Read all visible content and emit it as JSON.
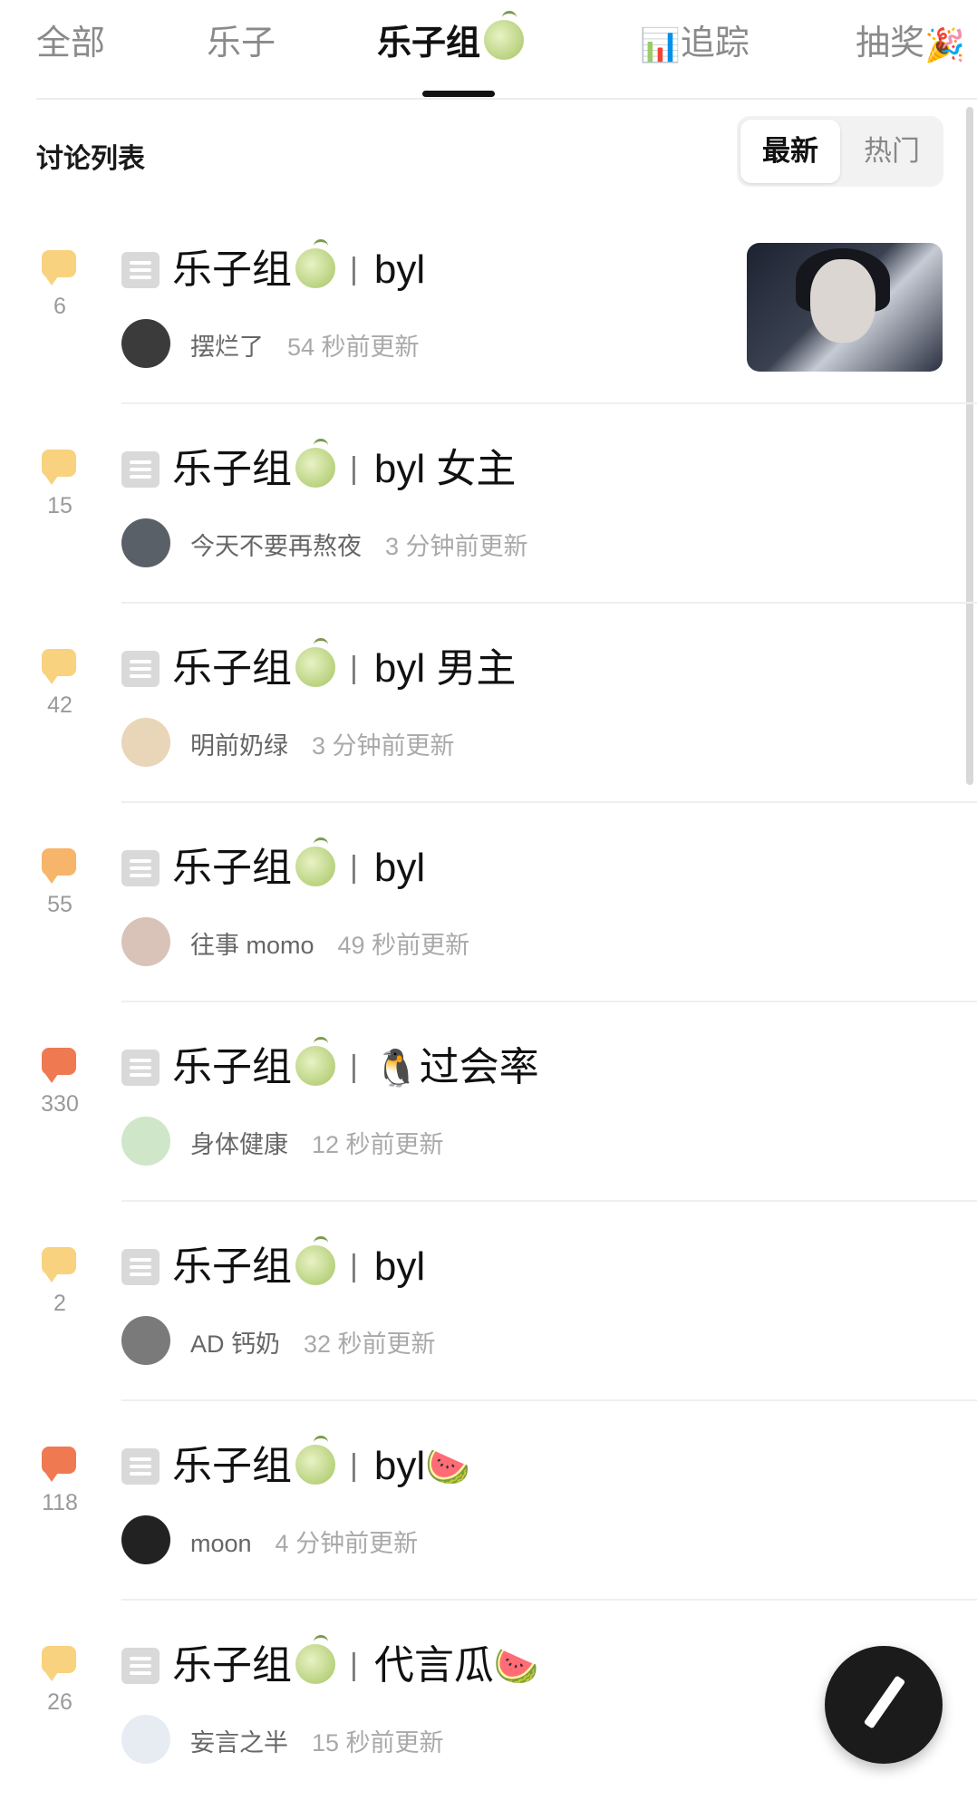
{
  "tabs": [
    {
      "label": "全部",
      "emoji": ""
    },
    {
      "label": "乐子",
      "emoji": ""
    },
    {
      "label": "乐子组",
      "emoji": "melon"
    },
    {
      "label": "追踪",
      "emoji": "📊"
    },
    {
      "label": "抽奖",
      "emoji": "🎉"
    }
  ],
  "active_tab": "乐子组",
  "section": {
    "title": "讨论列表",
    "sort_options": [
      "最新",
      "热门"
    ],
    "active_sort": "最新"
  },
  "colors": {
    "bubble_normal": "#f8d27e",
    "bubble_warm": "#f6b56a",
    "bubble_hot": "#ef7a52"
  },
  "posts": [
    {
      "count": "6",
      "bubble": "bubble_normal",
      "group": "乐子组",
      "sep": "|",
      "title": "byl",
      "title_emoji": "",
      "author": "摆烂了",
      "time": "54 秒前更新",
      "has_thumbnail": true
    },
    {
      "count": "15",
      "bubble": "bubble_normal",
      "group": "乐子组",
      "sep": "|",
      "title": "byl 女主",
      "title_emoji": "",
      "author": "今天不要再熬夜",
      "time": "3 分钟前更新",
      "has_thumbnail": false
    },
    {
      "count": "42",
      "bubble": "bubble_normal",
      "group": "乐子组",
      "sep": "|",
      "title": "byl 男主",
      "title_emoji": "",
      "author": "明前奶绿",
      "time": "3 分钟前更新",
      "has_thumbnail": false
    },
    {
      "count": "55",
      "bubble": "bubble_warm",
      "group": "乐子组",
      "sep": "|",
      "title": "byl",
      "title_emoji": "",
      "author": "往事 momo",
      "time": "49 秒前更新",
      "has_thumbnail": false
    },
    {
      "count": "330",
      "bubble": "bubble_hot",
      "group": "乐子组",
      "sep": "|",
      "title": "过会率",
      "title_emoji_before": "🐧",
      "title_emoji": "",
      "author": "身体健康",
      "time": "12 秒前更新",
      "has_thumbnail": false
    },
    {
      "count": "2",
      "bubble": "bubble_normal",
      "group": "乐子组",
      "sep": "|",
      "title": "byl",
      "title_emoji": "",
      "author": "AD 钙奶",
      "time": "32 秒前更新",
      "has_thumbnail": false
    },
    {
      "count": "118",
      "bubble": "bubble_hot",
      "group": "乐子组",
      "sep": "|",
      "title": "byl",
      "title_emoji": "🍉",
      "author": "moon",
      "time": "4 分钟前更新",
      "has_thumbnail": false
    },
    {
      "count": "26",
      "bubble": "bubble_normal",
      "group": "乐子组",
      "sep": "|",
      "title": "代言瓜",
      "title_emoji": "🍉",
      "author": "妄言之半",
      "time": "15 秒前更新",
      "has_thumbnail": false
    }
  ],
  "icons": {
    "comment": "comment-bubble-icon",
    "doc": "document-icon",
    "fab": "pencil-icon"
  }
}
